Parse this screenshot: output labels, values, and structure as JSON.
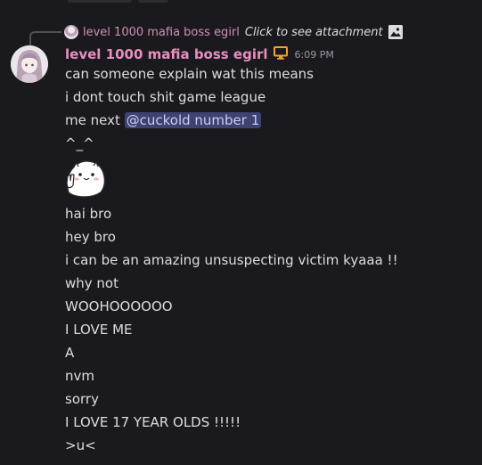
{
  "reply": {
    "username": "level 1000 mafia boss egirl",
    "text": "Click to see attachment"
  },
  "message": {
    "username": "level 1000 mafia boss egirl",
    "timestamp": "6:09 PM",
    "lines": [
      {
        "text": "can someone explain wat this means"
      },
      {
        "text": "i dont touch shit game league"
      },
      {
        "prefix": "me next ",
        "mention": "@cuckold number 1"
      },
      {
        "text": "^_^"
      },
      {
        "sticker": "white-blob-peace-sticker"
      },
      {
        "text": "hai bro"
      },
      {
        "text": "hey bro"
      },
      {
        "text": "i can be an amazing unsuspecting victim kyaaa !!"
      },
      {
        "text": "why not"
      },
      {
        "text": "WOOHOOOOOO"
      },
      {
        "text": "I LOVE ME"
      },
      {
        "text": "A"
      },
      {
        "text": "nvm"
      },
      {
        "text": "sorry"
      },
      {
        "text": "I LOVE 17 YEAR OLDS !!!!!"
      },
      {
        "text": ">u<"
      }
    ]
  },
  "colors": {
    "background": "#1a1a1e",
    "username": "#e78fbe",
    "mention_bg": "#3d4270",
    "mention_fg": "#c9cdfb",
    "text": "#dbdee1",
    "timestamp": "#949ba4"
  },
  "icons": {
    "reply_attachment": "image-icon",
    "activity": "monitor-icon"
  }
}
